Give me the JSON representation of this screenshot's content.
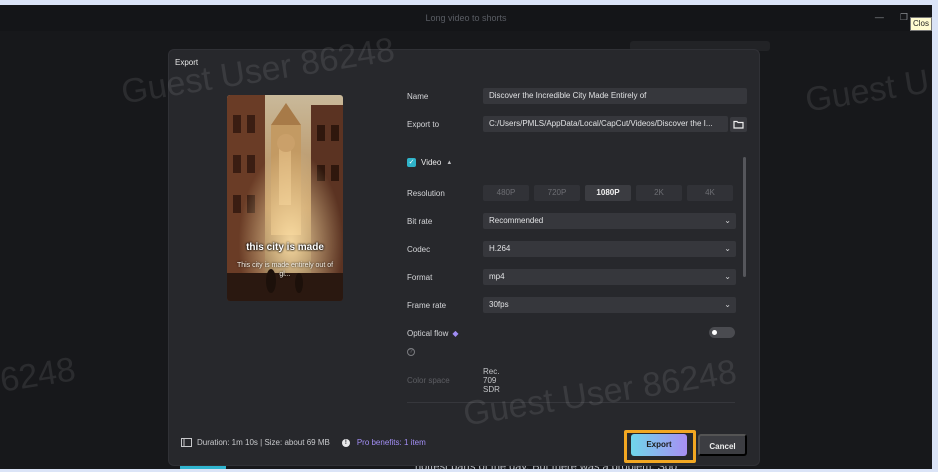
{
  "app": {
    "title": "Long video to shorts",
    "tooltip": "Clos",
    "minimize_glyph": "—",
    "restore_glyph": "❐"
  },
  "watermark": {
    "text_left_top": "Guest User 86248",
    "text_right": "Guest U",
    "text_left_bottom": "6248",
    "text_center_bottom": "Guest User 86248"
  },
  "background": {
    "caption": "hottest parts of the day. But there was a problem. Soo"
  },
  "dialog": {
    "title": "Export",
    "preview": {
      "title": "this city is made",
      "subtitle": "This city is made entirely out of gl..."
    },
    "name": {
      "label": "Name",
      "value": "Discover the Incredible City Made Entirely of"
    },
    "export_to": {
      "label": "Export to",
      "value": "C:/Users/PMLS/AppData/Local/CapCut/Videos/Discover the I..."
    },
    "video": {
      "label": "Video",
      "checked": true
    },
    "resolution": {
      "label": "Resolution",
      "options": [
        "480P",
        "720P",
        "1080P",
        "2K",
        "4K"
      ],
      "selected": "1080P"
    },
    "bit_rate": {
      "label": "Bit rate",
      "value": "Recommended"
    },
    "codec": {
      "label": "Codec",
      "value": "H.264"
    },
    "format": {
      "label": "Format",
      "value": "mp4"
    },
    "frame_rate": {
      "label": "Frame rate",
      "value": "30fps"
    },
    "optical_flow": {
      "label": "Optical flow",
      "enabled": false
    },
    "color_space": {
      "label": "Color space",
      "value": "Rec. 709 SDR"
    },
    "footer": {
      "duration_size": "Duration: 1m 10s | Size: about 69 MB",
      "pro_benefits": "Pro benefits: 1 item"
    },
    "buttons": {
      "export": "Export",
      "cancel": "Cancel"
    }
  },
  "colors": {
    "accent_teal": "#2fb3c9",
    "pro_purple": "#a28ef5",
    "highlight_orange": "#f2a722"
  }
}
